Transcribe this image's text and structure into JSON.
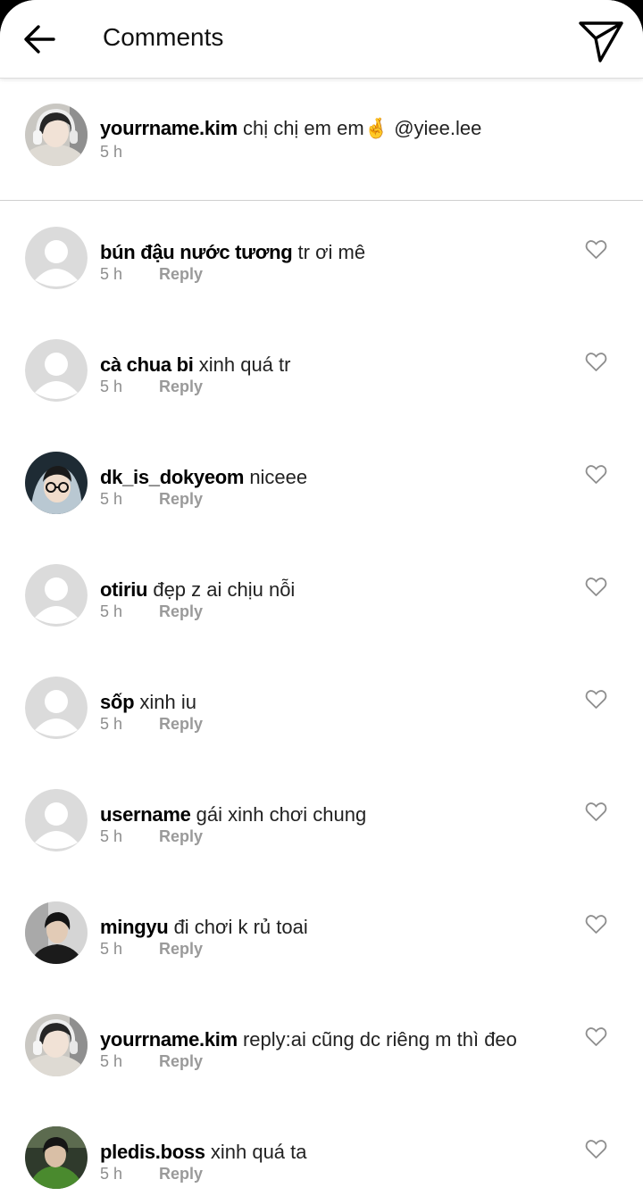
{
  "header": {
    "title": "Comments"
  },
  "caption": {
    "username": "yourrname.kim",
    "text": "chị chị em em",
    "emoji": "🤞",
    "mention": "@yiee.lee",
    "time": "5 h"
  },
  "comments": [
    {
      "username": "bún đậu nước tương",
      "text": "tr ơi mê",
      "time": "5 h",
      "reply": "Reply",
      "avatar": "default"
    },
    {
      "username": "cà chua bi",
      "text": "xinh quá tr",
      "time": "5 h",
      "reply": "Reply",
      "avatar": "default"
    },
    {
      "username": "dk_is_dokyeom",
      "text": "niceee",
      "time": "5 h",
      "reply": "Reply",
      "avatar": "photo-glasses"
    },
    {
      "username": "otiriu",
      "text": "đẹp z ai chịu nỗi",
      "time": "5 h",
      "reply": "Reply",
      "avatar": "default"
    },
    {
      "username": "sốp",
      "text": "xinh iu",
      "time": "5 h",
      "reply": "Reply",
      "avatar": "default"
    },
    {
      "username": "username",
      "text": "gái xinh chơi chung",
      "time": "5 h",
      "reply": "Reply",
      "avatar": "default"
    },
    {
      "username": "mingyu",
      "text": "đi chơi k rủ toai",
      "time": "5 h",
      "reply": "Reply",
      "avatar": "photo-dark"
    },
    {
      "username": "yourrname.kim",
      "text": "reply:ai cũng dc riêng m thì đeo",
      "time": "5 h",
      "reply": "Reply",
      "avatar": "photo-headphones"
    },
    {
      "username": "pledis.boss",
      "text": "xinh quá ta",
      "time": "5 h",
      "reply": "Reply",
      "avatar": "photo-green"
    }
  ]
}
